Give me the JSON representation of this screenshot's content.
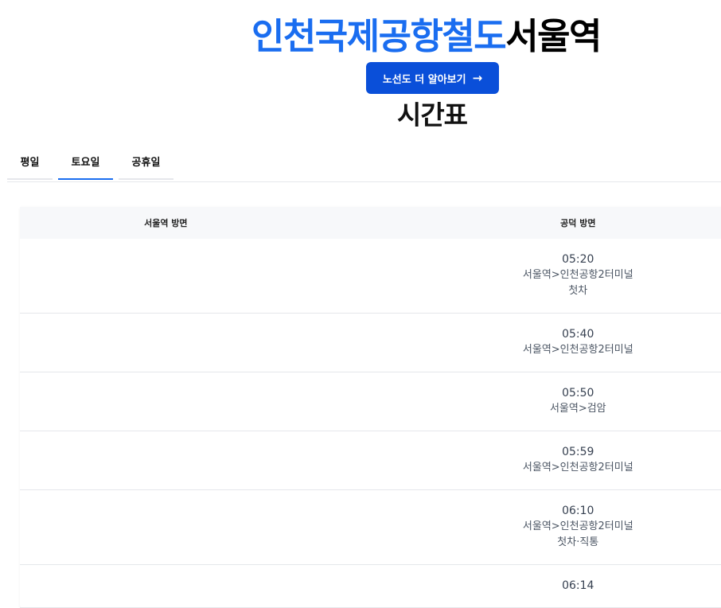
{
  "header": {
    "line_name": "인천국제공항철도",
    "station_name": "서울역",
    "route_button_label": "노선도 더 알아보기",
    "route_button_icon": "→",
    "subtitle": "시간표"
  },
  "tabs": [
    {
      "label": "평일",
      "active": false
    },
    {
      "label": "토요일",
      "active": true
    },
    {
      "label": "공휴일",
      "active": false
    }
  ],
  "colors": {
    "accent": "#1a6df0",
    "button": "#0a4fd9"
  },
  "timetable": {
    "columns": [
      "서울역 방면",
      "공덕 방면"
    ],
    "rows": [
      {
        "left": "",
        "time": "05:20",
        "dest": "서울역>인천공항2터미널",
        "note": "첫차"
      },
      {
        "left": "",
        "time": "05:40",
        "dest": "서울역>인천공항2터미널",
        "note": ""
      },
      {
        "left": "",
        "time": "05:50",
        "dest": "서울역>검암",
        "note": ""
      },
      {
        "left": "",
        "time": "05:59",
        "dest": "서울역>인천공항2터미널",
        "note": ""
      },
      {
        "left": "",
        "time": "06:10",
        "dest": "서울역>인천공항2터미널",
        "note": "첫차·직통"
      },
      {
        "left": "",
        "time": "06:14",
        "dest": "",
        "note": ""
      }
    ]
  }
}
